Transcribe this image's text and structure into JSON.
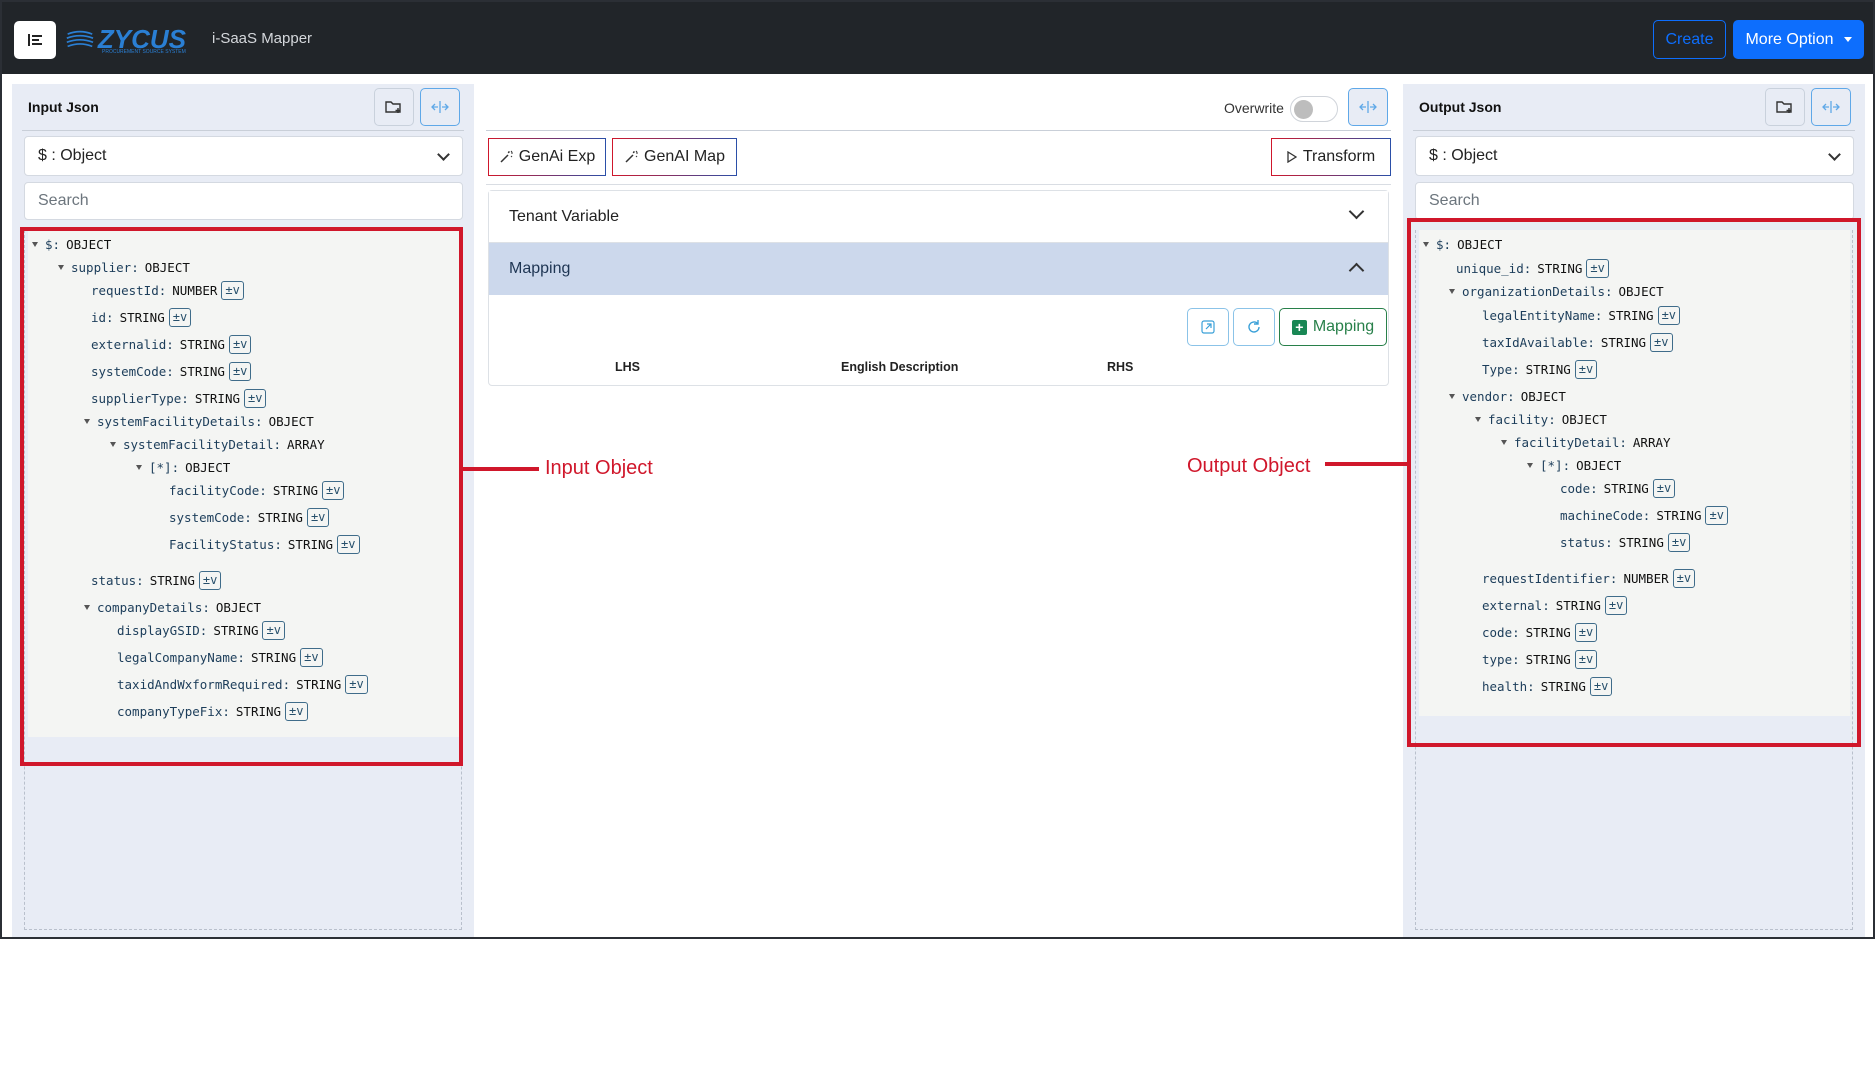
{
  "header": {
    "logo_text": "ZYCUS",
    "logo_subtitle": "PROCUREMENT SOURCE SYSTEM",
    "title": "i-SaaS Mapper",
    "create_label": "Create",
    "more_label": "More Option"
  },
  "input_panel": {
    "title": "Input Json",
    "select_value": "$ : Object",
    "search_placeholder": "Search",
    "annotation": "Input Object",
    "tree": [
      {
        "key": "$",
        "type": "OBJECT",
        "level": 0,
        "caret": true
      },
      {
        "key": "supplier",
        "type": "OBJECT",
        "level": 1,
        "caret": true
      },
      {
        "key": "requestId",
        "type": "NUMBER",
        "level": 2,
        "tv": true
      },
      {
        "key": "id",
        "type": "STRING",
        "level": 2,
        "tv": true
      },
      {
        "key": "externalid",
        "type": "STRING",
        "level": 2,
        "tv": true
      },
      {
        "key": "systemCode",
        "type": "STRING",
        "level": 2,
        "tv": true
      },
      {
        "key": "supplierType",
        "type": "STRING",
        "level": 2,
        "tv": true
      },
      {
        "key": "systemFacilityDetails",
        "type": "OBJECT",
        "level": 2,
        "caret": true
      },
      {
        "key": "systemFacilityDetail",
        "type": "ARRAY",
        "level": 3,
        "caret": true
      },
      {
        "key": "[*]",
        "type": "OBJECT",
        "level": 4,
        "caret": true
      },
      {
        "key": "facilityCode",
        "type": "STRING",
        "level": 5,
        "tv": true
      },
      {
        "key": "systemCode",
        "type": "STRING",
        "level": 5,
        "tv": true
      },
      {
        "key": "FacilityStatus",
        "type": "STRING",
        "level": 5,
        "tv": true
      },
      {
        "key": "status",
        "type": "STRING",
        "level": 2,
        "tv": true
      },
      {
        "key": "companyDetails",
        "type": "OBJECT",
        "level": 2,
        "caret": true
      },
      {
        "key": "displayGSID",
        "type": "STRING",
        "level": 3,
        "tv": true
      },
      {
        "key": "legalCompanyName",
        "type": "STRING",
        "level": 3,
        "tv": true
      },
      {
        "key": "taxidAndWxformRequired",
        "type": "STRING",
        "level": 3,
        "tv": true
      },
      {
        "key": "companyTypeFix",
        "type": "STRING",
        "level": 3,
        "tv": true
      }
    ]
  },
  "middle": {
    "overwrite_label": "Overwrite",
    "genai_exp_label": "GenAi Exp",
    "genai_map_label": "GenAI Map",
    "transform_label": "Transform",
    "tenant_variable_label": "Tenant Variable",
    "mapping_section_label": "Mapping",
    "mapping_button_label": "Mapping",
    "columns": [
      "LHS",
      "English Description",
      "RHS"
    ]
  },
  "output_panel": {
    "title": "Output Json",
    "select_value": "$ : Object",
    "search_placeholder": "Search",
    "annotation": "Output Object",
    "tree": [
      {
        "key": "$",
        "type": "OBJECT",
        "level": 0,
        "caret": true
      },
      {
        "key": "unique_id",
        "type": "STRING",
        "level": 1,
        "tv": true
      },
      {
        "key": "organizationDetails",
        "type": "OBJECT",
        "level": 1,
        "caret": true
      },
      {
        "key": "legalEntityName",
        "type": "STRING",
        "level": 2,
        "tv": true
      },
      {
        "key": "taxIdAvailable",
        "type": "STRING",
        "level": 2,
        "tv": true
      },
      {
        "key": "Type",
        "type": "STRING",
        "level": 2,
        "tv": true
      },
      {
        "key": "vendor",
        "type": "OBJECT",
        "level": 1,
        "caret": true
      },
      {
        "key": "facility",
        "type": "OBJECT",
        "level": 2,
        "caret": true
      },
      {
        "key": "facilityDetail",
        "type": "ARRAY",
        "level": 3,
        "caret": true
      },
      {
        "key": "[*]",
        "type": "OBJECT",
        "level": 4,
        "caret": true
      },
      {
        "key": "code",
        "type": "STRING",
        "level": 5,
        "tv": true
      },
      {
        "key": "machineCode",
        "type": "STRING",
        "level": 5,
        "tv": true
      },
      {
        "key": "status",
        "type": "STRING",
        "level": 5,
        "tv": true
      },
      {
        "key": "requestIdentifier",
        "type": "NUMBER",
        "level": 2,
        "tv": true
      },
      {
        "key": "external",
        "type": "STRING",
        "level": 2,
        "tv": true
      },
      {
        "key": "code",
        "type": "STRING",
        "level": 2,
        "tv": true
      },
      {
        "key": "type",
        "type": "STRING",
        "level": 2,
        "tv": true
      },
      {
        "key": "health",
        "type": "STRING",
        "level": 2,
        "tv": true
      }
    ]
  },
  "tv_label": "±v",
  "colors": {
    "accent": "#0d6efd",
    "annotation": "#d0172b",
    "topbar": "#212529"
  }
}
